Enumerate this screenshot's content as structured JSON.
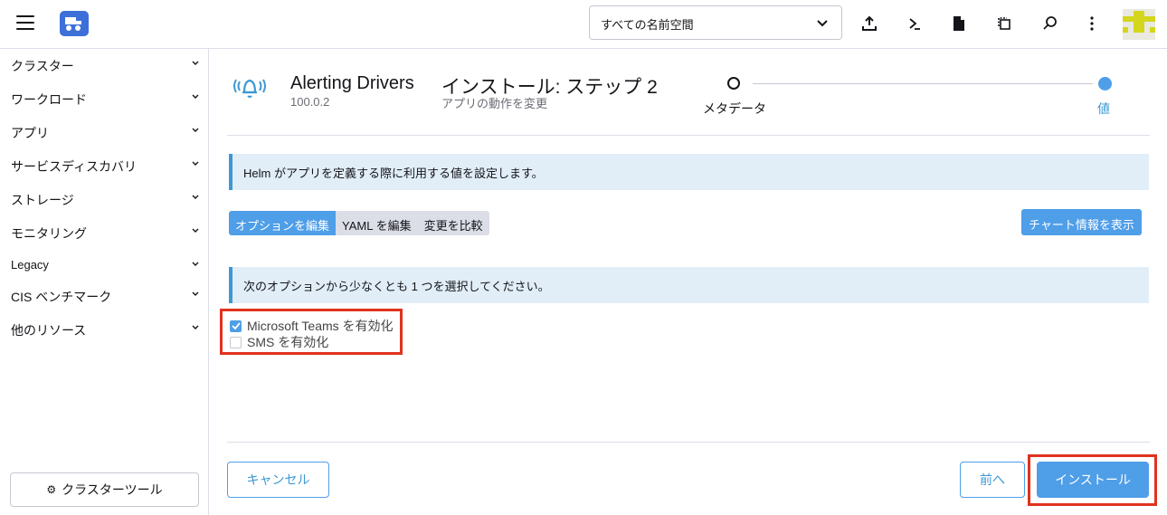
{
  "header": {
    "namespace_select": "すべての名前空間",
    "icons": [
      "import-yaml-icon",
      "kubectl-shell-icon",
      "kubeconfig-file-icon",
      "copy-kubeconfig-icon",
      "search-icon",
      "more-menu-icon"
    ]
  },
  "sidebar": {
    "items": [
      {
        "label": "クラスター"
      },
      {
        "label": "ワークロード"
      },
      {
        "label": "アプリ"
      },
      {
        "label": "サービスディスカバリ"
      },
      {
        "label": "ストレージ"
      },
      {
        "label": "モニタリング"
      },
      {
        "label": "Legacy"
      },
      {
        "label": "CIS ベンチマーク"
      },
      {
        "label": "他のリソース"
      }
    ],
    "cluster_tools": "クラスターツール"
  },
  "app": {
    "name": "Alerting Drivers",
    "version": "100.0.2"
  },
  "step": {
    "title": "インストール: ステップ 2",
    "subtitle": "アプリの動作を変更",
    "steps": [
      "メタデータ",
      "値"
    ],
    "current": 2
  },
  "info_banner": "Helm がアプリを定義する際に利用する値を設定します。",
  "tabs": [
    "オプションを編集",
    "YAML を編集",
    "変更を比較"
  ],
  "chart_info_button": "チャート情報を表示",
  "options_banner": "次のオプションから少なくとも 1 つを選択してください。",
  "options": [
    {
      "label": "Microsoft Teams を有効化",
      "checked": true
    },
    {
      "label": "SMS を有効化",
      "checked": false
    }
  ],
  "footer": {
    "cancel": "キャンセル",
    "previous": "前へ",
    "install": "インストール"
  },
  "colors": {
    "accent": "#4f9ee8",
    "highlight_frame": "#e0321e",
    "banner_bg": "#e1eef8"
  }
}
